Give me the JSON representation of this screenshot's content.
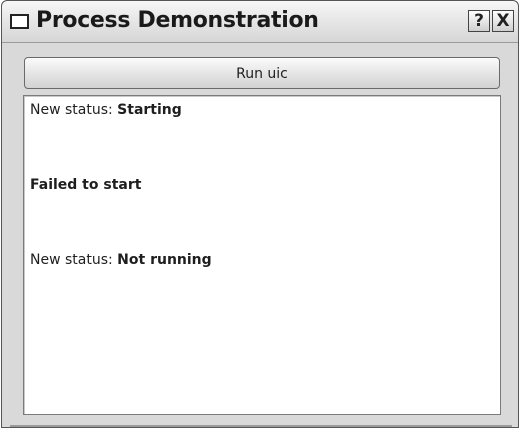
{
  "window": {
    "title": "Process Demonstration",
    "help_label": "?",
    "close_label": "X"
  },
  "run_button": {
    "label": "Run uic"
  },
  "output": {
    "lines": [
      {
        "prefix": "New status: ",
        "value": "Starting"
      },
      {
        "prefix": "",
        "value": "Failed to start"
      },
      {
        "prefix": "New status: ",
        "value": "Not running"
      }
    ]
  },
  "icons": {
    "window_icon": "window-icon",
    "help": "help-icon",
    "close": "close-icon"
  }
}
